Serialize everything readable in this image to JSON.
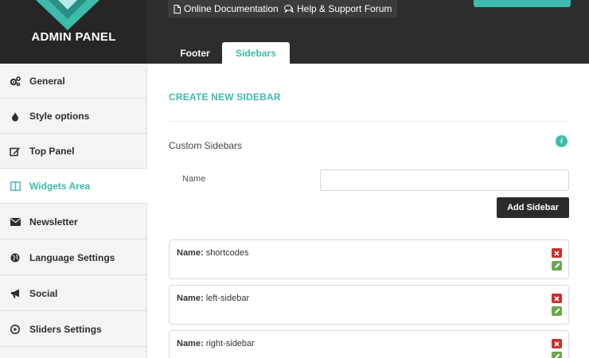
{
  "brand": {
    "name": "ADMIN PANEL",
    "logo": "admin-logo"
  },
  "top_links": [
    {
      "label": "Online Documentation",
      "icon": "document-icon"
    },
    {
      "label": "Help & Support Forum",
      "icon": "chat-icon"
    }
  ],
  "tabs": [
    {
      "label": "Footer",
      "active": false
    },
    {
      "label": "Sidebars",
      "active": true
    }
  ],
  "nav": [
    {
      "label": "General",
      "icon": "gears-icon",
      "active": false
    },
    {
      "label": "Style options",
      "icon": "droplet-icon",
      "active": false
    },
    {
      "label": "Top Panel",
      "icon": "edit-icon",
      "active": false
    },
    {
      "label": "Widgets Area",
      "icon": "columns-icon",
      "active": true
    },
    {
      "label": "Newsletter",
      "icon": "envelope-icon",
      "active": false
    },
    {
      "label": "Language Settings",
      "icon": "globe-icon",
      "active": false
    },
    {
      "label": "Social",
      "icon": "bullhorn-icon",
      "active": false
    },
    {
      "label": "Sliders Settings",
      "icon": "play-circle-icon",
      "active": false
    }
  ],
  "main": {
    "section_title": "CREATE NEW SIDEBAR",
    "custom_sidebars_label": "Custom Sidebars",
    "info_icon": "i",
    "name_label": "Name",
    "name_value": "",
    "name_placeholder": "",
    "add_button": "Add  Sidebar",
    "name_prefix": "Name:",
    "sidebars": [
      "shortcodes",
      "left-sidebar",
      "right-sidebar"
    ]
  },
  "colors": {
    "accent": "#3dbbad",
    "header": "#2d2d2d",
    "delete": "#c9302c",
    "edit": "#6aa84f"
  }
}
